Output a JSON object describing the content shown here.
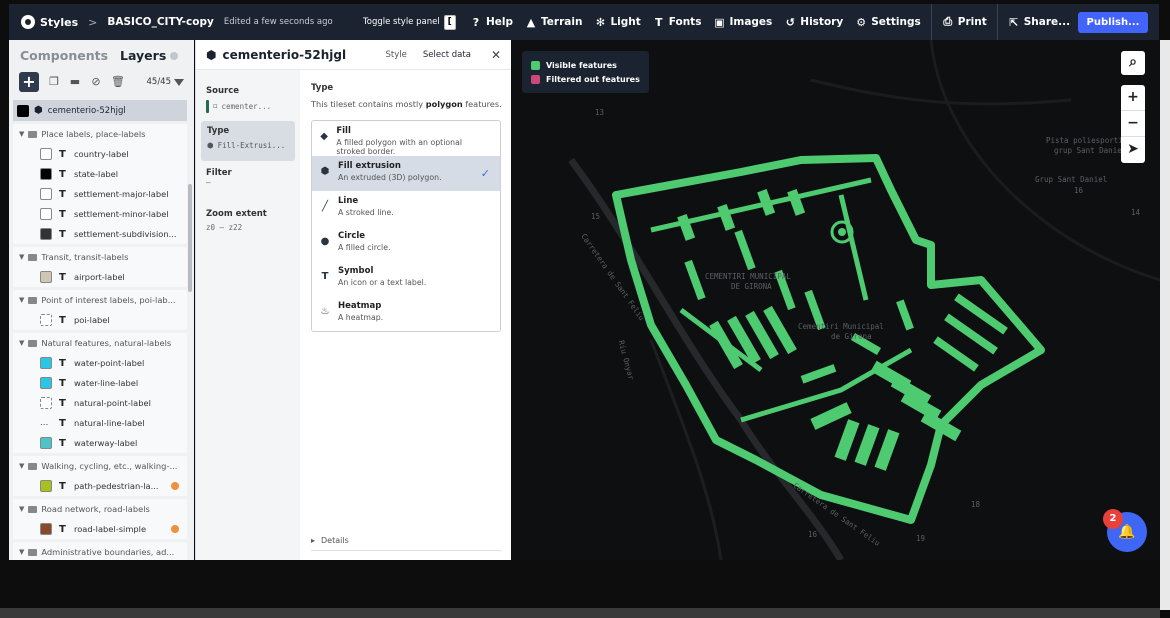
{
  "header": {
    "app_name": "Styles",
    "style_name": "BASICO_CITY-copy",
    "edited_status": "Edited a few seconds ago",
    "toggle_panel_label": "Toggle style panel",
    "toggle_key": "[",
    "menu": [
      "Help",
      "Terrain",
      "Light",
      "Fonts",
      "Images",
      "History",
      "Settings",
      "Print",
      "Share..."
    ],
    "publish_label": "Publish..."
  },
  "sidebar": {
    "tab_components": "Components",
    "tab_layers": "Layers",
    "layer_count": "45/45",
    "selected_layer": "cementerio-52hjgl",
    "groups": [
      {
        "name": "Place labels, place-labels",
        "layers": [
          "country-label",
          "state-label",
          "settlement-major-label",
          "settlement-minor-label",
          "settlement-subdivision..."
        ]
      },
      {
        "name": "Transit, transit-labels",
        "layers": [
          "airport-label"
        ]
      },
      {
        "name": "Point of interest labels, poi-lab...",
        "layers": [
          "poi-label"
        ]
      },
      {
        "name": "Natural features, natural-labels",
        "layers": [
          "water-point-label",
          "water-line-label",
          "natural-point-label",
          "natural-line-label",
          "waterway-label"
        ]
      },
      {
        "name": "Walking, cycling, etc., walking-...",
        "layers": [
          "path-pedestrian-la..."
        ]
      },
      {
        "name": "Road network, road-labels",
        "layers": [
          "road-label-simple"
        ]
      },
      {
        "name": "Administrative boundaries, ad..."
      }
    ]
  },
  "detail": {
    "title": "cementerio-52hjgl",
    "tab_style": "Style",
    "tab_select_data": "Select data",
    "source_label": "Source",
    "source_value": "cementer...",
    "type_label": "Type",
    "type_value": "Fill-Extrusi...",
    "filter_label": "Filter",
    "filter_value": "—",
    "zoom_label": "Zoom extent",
    "zoom_value": "z0 – z22",
    "type_heading": "Type",
    "type_desc_prefix": "This tileset contains mostly",
    "type_desc_bold": "polygon",
    "type_desc_suffix": "features.",
    "options": [
      {
        "name": "Fill",
        "desc": "A filled polygon with an optional stroked border.",
        "icon": "fill-icon"
      },
      {
        "name": "Fill extrusion",
        "desc": "An extruded (3D) polygon.",
        "icon": "fill-extrusion-icon",
        "selected": true
      },
      {
        "name": "Line",
        "desc": "A stroked line.",
        "icon": "line-icon"
      },
      {
        "name": "Circle",
        "desc": "A filled circle.",
        "icon": "circle-icon"
      },
      {
        "name": "Symbol",
        "desc": "An icon or a text label.",
        "icon": "symbol-icon"
      },
      {
        "name": "Heatmap",
        "desc": "A heatmap.",
        "icon": "heatmap-icon"
      }
    ],
    "details_label": "Details"
  },
  "map": {
    "legend_visible": "Visible features",
    "legend_filtered": "Filtered out features",
    "visible_color": "#4ecb71",
    "filtered_color": "#c94a7a",
    "notification_count": "2",
    "labels": {
      "cemetery_1": "CEMENTIRI MUNICIPAL",
      "cemetery_1b": "DE GIRONA",
      "cemetery_2": "Cementiri Municipal",
      "cemetery_2b": "de Girona",
      "road_1": "Carretera de Sant Feliu",
      "road_2": "Carretera de Sant Feliu",
      "river": "Riu Onyar",
      "pista": "Pista poliesportiva",
      "pista_b": "grup Sant Daniel",
      "grup": "Grup Sant Daniel",
      "n13": "13",
      "n15": "15",
      "n16": "16",
      "n14": "14",
      "n19": "19",
      "n16b": "16",
      "n18": "18"
    }
  }
}
